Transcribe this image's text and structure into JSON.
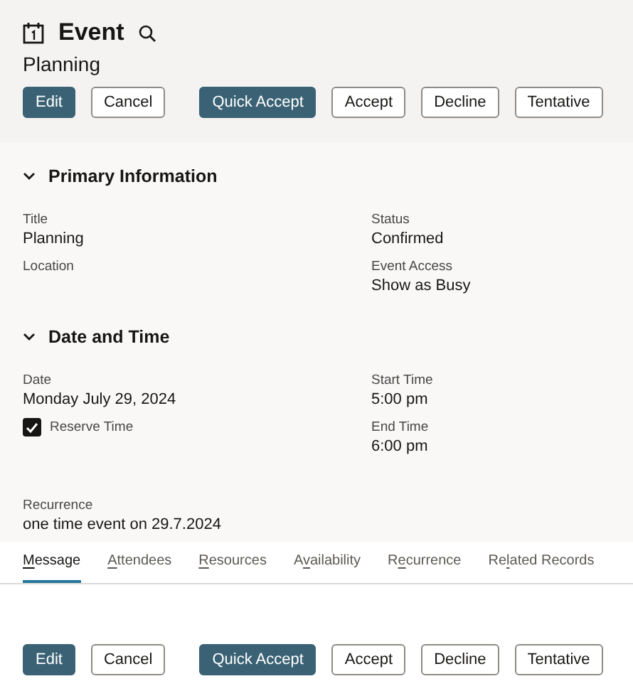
{
  "header": {
    "title": "Event",
    "subtitle": "Planning"
  },
  "toolbar": [
    [
      {
        "label": "Edit",
        "kind": "primary"
      },
      {
        "label": "Cancel",
        "kind": "secondary"
      }
    ],
    [
      {
        "label": "Quick Accept",
        "kind": "primary"
      },
      {
        "label": "Accept",
        "kind": "secondary"
      },
      {
        "label": "Decline",
        "kind": "secondary"
      },
      {
        "label": "Tentative",
        "kind": "secondary"
      }
    ]
  ],
  "sections": [
    {
      "title": "Primary Information",
      "expanded": true,
      "left": [
        {
          "kind": "field",
          "label": "Title",
          "value": "Planning"
        },
        {
          "kind": "field",
          "label": "Location"
        }
      ],
      "right": [
        {
          "kind": "field",
          "label": "Status",
          "value": "Confirmed"
        },
        {
          "kind": "field",
          "label": "Event Access",
          "value": "Show as Busy"
        }
      ]
    },
    {
      "title": "Date and Time",
      "expanded": true,
      "left": [
        {
          "kind": "field",
          "label": "Date",
          "value": "Monday July 29, 2024"
        },
        {
          "kind": "checkbox",
          "label": "Reserve Time",
          "checked": true
        }
      ],
      "right": [
        {
          "kind": "field",
          "label": "Start Time",
          "value": "5:00 pm"
        },
        {
          "kind": "field",
          "label": "End Time",
          "value": "6:00 pm"
        }
      ],
      "below": [
        {
          "kind": "field",
          "label": "Recurrence",
          "value": "one time event on 29.7.2024"
        }
      ]
    }
  ],
  "tabs": [
    {
      "access_key": "M",
      "after": "essage",
      "selected": true
    },
    {
      "access_key": "A",
      "after": "ttendees",
      "selected": false
    },
    {
      "access_key": "R",
      "after": "esources",
      "selected": false
    },
    {
      "before": "A",
      "access_key": "v",
      "after": "ailability",
      "selected": false
    },
    {
      "before": "R",
      "access_key": "e",
      "after": "currence",
      "selected": false
    },
    {
      "before": "Re",
      "access_key": "l",
      "after": "ated Records",
      "selected": false
    }
  ],
  "footer_toolbar": [
    [
      {
        "label": "Edit",
        "kind": "primary"
      },
      {
        "label": "Cancel",
        "kind": "secondary"
      }
    ],
    [
      {
        "label": "Quick Accept",
        "kind": "primary"
      },
      {
        "label": "Accept",
        "kind": "secondary"
      },
      {
        "label": "Decline",
        "kind": "secondary"
      },
      {
        "label": "Tentative",
        "kind": "secondary"
      }
    ]
  ]
}
